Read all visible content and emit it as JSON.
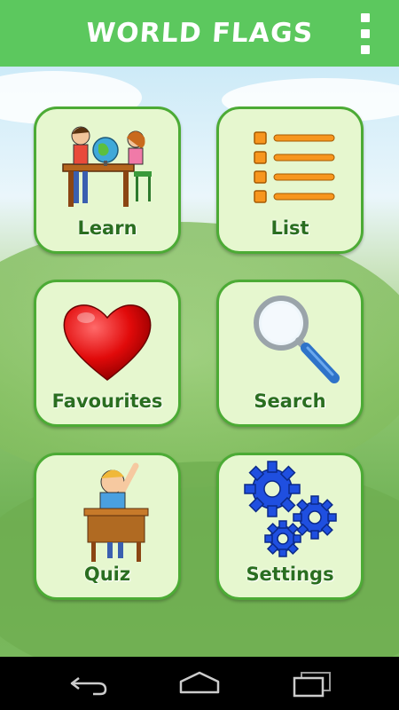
{
  "app": {
    "title": "WORLD FLAGS"
  },
  "menu": {
    "items": [
      {
        "label": "Learn",
        "icon": "kids-globe-icon"
      },
      {
        "label": "List",
        "icon": "list-icon"
      },
      {
        "label": "Favourites",
        "icon": "heart-icon"
      },
      {
        "label": "Search",
        "icon": "magnifier-icon"
      },
      {
        "label": "Quiz",
        "icon": "student-raising-hand-icon"
      },
      {
        "label": "Settings",
        "icon": "gears-icon"
      }
    ]
  },
  "colors": {
    "appbar": "#5cc85e",
    "tile_bg": "#e6f7cf",
    "tile_border": "#4cab35",
    "label": "#2a6e20"
  },
  "navbar": {
    "buttons": [
      "back-icon",
      "home-icon",
      "recents-icon"
    ]
  }
}
